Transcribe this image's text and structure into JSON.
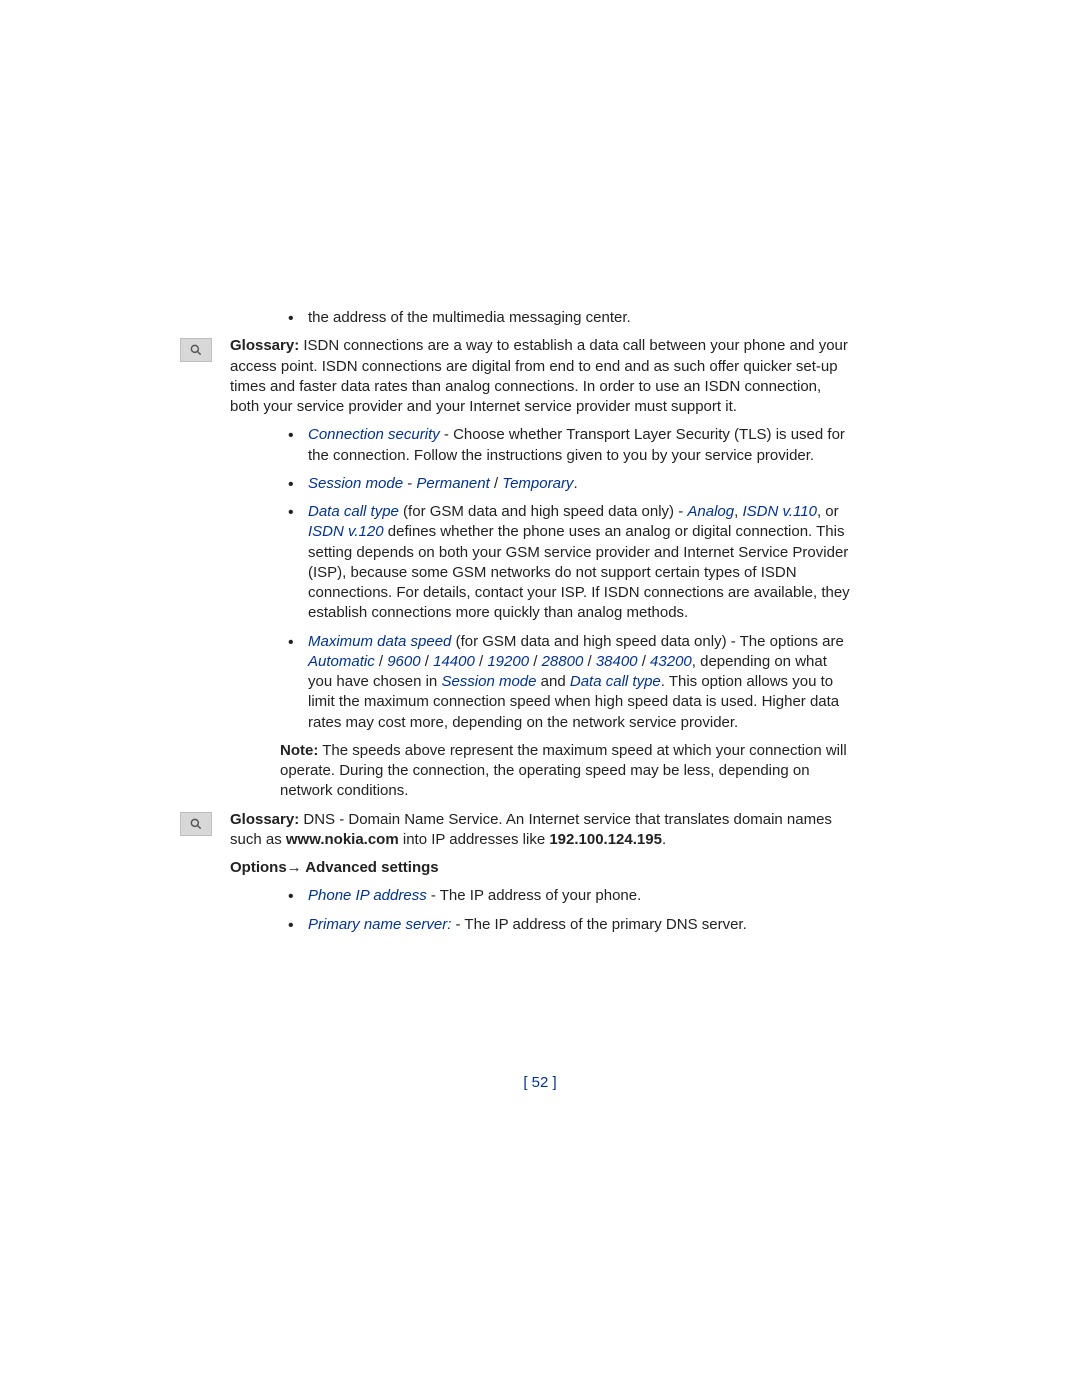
{
  "intro_bullet": "the address of the multimedia messaging center.",
  "glossary1": {
    "label": "Glossary:",
    "text": " ISDN connections are a way to establish a data call between your phone and your access point. ISDN connections are digital from end to end and as such offer quicker set-up times and faster data rates than analog connections. In order to use an ISDN connection, both your service provider and your Internet service provider must support it."
  },
  "bullets": {
    "b1": {
      "term": "Connection security",
      "rest": " - Choose whether Transport Layer Security (TLS) is used for the connection. Follow the instructions given to you by your service provider."
    },
    "b2": {
      "term": "Session mode",
      "dash": " - ",
      "opt1": "Permanent",
      "sep": " / ",
      "opt2": "Temporary",
      "period": "."
    },
    "b3": {
      "term": "Data call type",
      "rest1": " (for GSM data and high speed data only) - ",
      "opt1": "Analog",
      "comma": ", ",
      "opt2": "ISDN v.110",
      "or": ", or ",
      "opt3": "ISDN v.120",
      "rest2": " defines whether the phone uses an analog or digital connection. This setting depends on both your GSM service provider and Internet Service Provider (ISP), because some GSM networks do not support certain types of ISDN connections. For details, contact your ISP. If ISDN connections are available, they establish connections more quickly than analog methods."
    },
    "b4": {
      "term": "Maximum data speed",
      "rest1": " (for GSM data and high speed data only) - The options are ",
      "o1": "Automatic",
      "s1": " / ",
      "o2": "9600",
      "s2": " / ",
      "o3": "14400",
      "s3": " / ",
      "o4": "19200",
      "s4": " / ",
      "o5": "28800",
      "s5": " / ",
      "o6": "38400",
      "s6": " / ",
      "o7": "43200",
      "rest2": ", depending on what you have chosen in ",
      "ref1": "Session mode",
      "and": " and ",
      "ref2": "Data call type",
      "rest3": ". This option allows you to limit the maximum connection speed when high speed data is used. Higher data rates may cost more, depending on the network service provider."
    }
  },
  "note": {
    "label": "Note:",
    "text": "  The speeds above represent the maximum speed at which your connection will operate. During the connection, the operating speed may be less, depending on network conditions."
  },
  "glossary2": {
    "label": "Glossary:",
    "text1": " DNS - Domain Name Service. An Internet service that translates domain names such as ",
    "domain": "www.nokia.com",
    "text2": " into IP addresses like ",
    "ip": "192.100.124.195",
    "period": "."
  },
  "options_heading": "Options→ Advanced settings",
  "adv": {
    "a1": {
      "term": "Phone IP address",
      "rest": " - The IP address of your phone."
    },
    "a2": {
      "term": "Primary name server:",
      "rest": " - The IP address of the primary DNS server."
    }
  },
  "page_number": "[ 52 ]"
}
